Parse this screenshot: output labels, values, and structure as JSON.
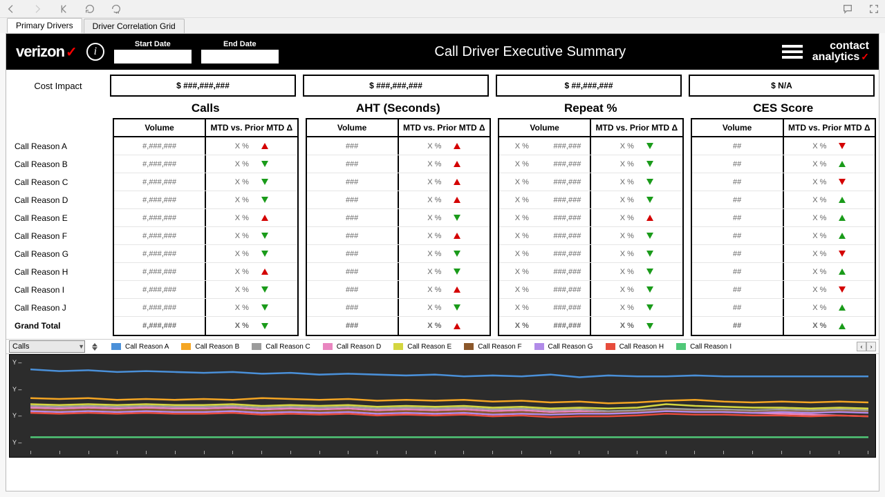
{
  "tabs": [
    {
      "label": "Primary Drivers",
      "active": true
    },
    {
      "label": "Driver Correlation Grid",
      "active": false
    }
  ],
  "header": {
    "brand": "verizon",
    "title": "Call Driver Executive Summary",
    "start_date_label": "Start Date",
    "end_date_label": "End Date",
    "start_date_value": "",
    "end_date_value": "",
    "right_brand_l1": "contact",
    "right_brand_l2": "analytics"
  },
  "cost_impact": {
    "label": "Cost Impact",
    "cards": [
      "$ ###,###,###",
      "$ ###,###,###",
      "$ ##,###,###",
      "$ N/A"
    ]
  },
  "metrics": {
    "columns": [
      {
        "title": "Calls",
        "headers": [
          "Volume",
          "MTD vs. Prior MTD Δ"
        ]
      },
      {
        "title": "AHT (Seconds)",
        "headers": [
          "Volume",
          "MTD vs. Prior MTD Δ"
        ]
      },
      {
        "title": "Repeat %",
        "headers": [
          "Volume",
          "MTD vs. Prior MTD Δ"
        ],
        "split_volume": true
      },
      {
        "title": "CES Score",
        "headers": [
          "Volume",
          "MTD vs. Prior MTD Δ"
        ]
      }
    ],
    "reasons": [
      "Call Reason A",
      "Call Reason B",
      "Call Reason C",
      "Call Reason D",
      "Call Reason E",
      "Call Reason F",
      "Call Reason G",
      "Call Reason H",
      "Call Reason I",
      "Call Reason J",
      "Grand Total"
    ],
    "cells": {
      "calls_volume": [
        "#,###,###",
        "#,###,###",
        "#,###,###",
        "#,###,###",
        "#,###,###",
        "#,###,###",
        "#,###,###",
        "#,###,###",
        "#,###,###",
        "#,###,###",
        "#,###,###"
      ],
      "calls_delta": [
        "X %",
        "X %",
        "X %",
        "X %",
        "X %",
        "X %",
        "X %",
        "X %",
        "X %",
        "X %",
        "X %"
      ],
      "calls_dir": [
        "up",
        "down",
        "down",
        "down",
        "up",
        "down",
        "down",
        "up",
        "down",
        "down",
        "down"
      ],
      "aht_volume": [
        "###",
        "###",
        "###",
        "###",
        "###",
        "###",
        "###",
        "###",
        "###",
        "###",
        "###"
      ],
      "aht_delta": [
        "X %",
        "X %",
        "X %",
        "X %",
        "X %",
        "X %",
        "X %",
        "X %",
        "X %",
        "X %",
        "X %"
      ],
      "aht_dir": [
        "up",
        "up",
        "up",
        "up",
        "down",
        "up",
        "down",
        "down",
        "up",
        "down",
        "up"
      ],
      "repeat_vol_a": [
        "X %",
        "X %",
        "X %",
        "X %",
        "X %",
        "X %",
        "X %",
        "X %",
        "X %",
        "X %",
        "X %"
      ],
      "repeat_vol_b": [
        "###,###",
        "###,###",
        "###,###",
        "###,###",
        "###,###",
        "###,###",
        "###,###",
        "###,###",
        "###,###",
        "###,###",
        "###,###"
      ],
      "repeat_delta": [
        "X %",
        "X %",
        "X %",
        "X %",
        "X %",
        "X %",
        "X %",
        "X %",
        "X %",
        "X %",
        "X %"
      ],
      "repeat_dir": [
        "down",
        "down",
        "down",
        "down",
        "up",
        "down",
        "down",
        "down",
        "down",
        "down",
        "down"
      ],
      "ces_volume": [
        "##",
        "##",
        "##",
        "##",
        "##",
        "##",
        "##",
        "##",
        "##",
        "##",
        "##"
      ],
      "ces_delta": [
        "X %",
        "X %",
        "X %",
        "X %",
        "X %",
        "X %",
        "X %",
        "X %",
        "X %",
        "X %",
        "X %"
      ],
      "ces_dir": [
        "down-red",
        "up-green",
        "down-red",
        "up-green",
        "up-green",
        "up-green",
        "down-red",
        "up-green",
        "down-red",
        "up-green",
        "up-green"
      ]
    }
  },
  "chart_selector": {
    "value": "Calls"
  },
  "legend": {
    "items": [
      {
        "label": "Call Reason A",
        "color": "#4a90d9"
      },
      {
        "label": "Call Reason B",
        "color": "#f5a623"
      },
      {
        "label": "Call Reason C",
        "color": "#9b9b9b"
      },
      {
        "label": "Call Reason D",
        "color": "#e986c0"
      },
      {
        "label": "Call Reason E",
        "color": "#d4d640"
      },
      {
        "label": "Call Reason F",
        "color": "#8b572a"
      },
      {
        "label": "Call Reason G",
        "color": "#b18be8"
      },
      {
        "label": "Call Reason H",
        "color": "#e74c3c"
      },
      {
        "label": "Call Reason I",
        "color": "#50c878"
      }
    ]
  },
  "chart_data": {
    "type": "line",
    "title": "",
    "xlabel": "",
    "ylabel": "",
    "ylim": [
      0,
      100
    ],
    "y_ticks": [
      "Y",
      "Y",
      "Y",
      "Y"
    ],
    "x_tick_count": 30,
    "x": [
      0,
      1,
      2,
      3,
      4,
      5,
      6,
      7,
      8,
      9,
      10,
      11,
      12,
      13,
      14,
      15,
      16,
      17,
      18,
      19,
      20,
      21,
      22,
      23,
      24,
      25,
      26,
      27,
      28,
      29
    ],
    "series": [
      {
        "name": "Call Reason A",
        "color": "#4a90d9",
        "values": [
          88,
          86,
          87,
          85,
          86,
          85,
          84,
          85,
          83,
          84,
          82,
          83,
          82,
          81,
          82,
          80,
          81,
          80,
          82,
          79,
          81,
          80,
          80,
          81,
          80,
          80,
          80,
          80,
          80,
          80
        ]
      },
      {
        "name": "Call Reason B",
        "color": "#f5a623",
        "values": [
          55,
          54,
          55,
          53,
          54,
          53,
          54,
          53,
          55,
          54,
          53,
          54,
          52,
          53,
          52,
          53,
          51,
          52,
          50,
          51,
          49,
          50,
          52,
          53,
          51,
          50,
          51,
          50,
          51,
          50
        ]
      },
      {
        "name": "Call Reason C",
        "color": "#9b9b9b",
        "values": [
          46,
          45,
          46,
          45,
          46,
          45,
          45,
          46,
          44,
          45,
          44,
          45,
          43,
          44,
          43,
          44,
          42,
          43,
          41,
          42,
          40,
          41,
          43,
          42,
          42,
          41,
          42,
          41,
          42,
          41
        ]
      },
      {
        "name": "Call Reason D",
        "color": "#e986c0",
        "values": [
          44,
          43,
          44,
          43,
          44,
          43,
          43,
          44,
          42,
          43,
          42,
          43,
          41,
          42,
          41,
          42,
          40,
          41,
          39,
          40,
          38,
          39,
          41,
          40,
          39,
          38,
          37,
          36,
          35,
          34
        ]
      },
      {
        "name": "Call Reason E",
        "color": "#d4d640",
        "values": [
          48,
          47,
          48,
          47,
          48,
          47,
          47,
          48,
          46,
          47,
          46,
          47,
          45,
          46,
          45,
          46,
          44,
          45,
          43,
          44,
          43,
          44,
          48,
          46,
          45,
          44,
          44,
          43,
          44,
          43
        ]
      },
      {
        "name": "Call Reason F",
        "color": "#8b572a",
        "values": [
          42,
          41,
          42,
          41,
          42,
          41,
          41,
          42,
          40,
          41,
          40,
          41,
          39,
          40,
          39,
          40,
          38,
          39,
          37,
          38,
          38,
          39,
          41,
          40,
          40,
          39,
          40,
          39,
          40,
          39
        ]
      },
      {
        "name": "Call Reason G",
        "color": "#b18be8",
        "values": [
          40,
          39,
          40,
          39,
          40,
          39,
          39,
          40,
          38,
          39,
          38,
          39,
          37,
          38,
          37,
          38,
          36,
          37,
          36,
          37,
          37,
          38,
          40,
          39,
          39,
          38,
          39,
          38,
          39,
          38
        ]
      },
      {
        "name": "Call Reason H",
        "color": "#e74c3c",
        "values": [
          38,
          37,
          38,
          37,
          38,
          37,
          37,
          38,
          36,
          37,
          36,
          37,
          35,
          36,
          35,
          36,
          34,
          35,
          33,
          34,
          34,
          35,
          37,
          36,
          36,
          35,
          35,
          34,
          35,
          34
        ]
      },
      {
        "name": "Call Reason I",
        "color": "#50c878",
        "values": [
          10,
          10,
          10,
          10,
          10,
          10,
          10,
          10,
          10,
          10,
          10,
          10,
          10,
          10,
          10,
          10,
          10,
          10,
          10,
          10,
          10,
          10,
          10,
          10,
          10,
          10,
          10,
          10,
          10,
          10
        ]
      }
    ]
  }
}
